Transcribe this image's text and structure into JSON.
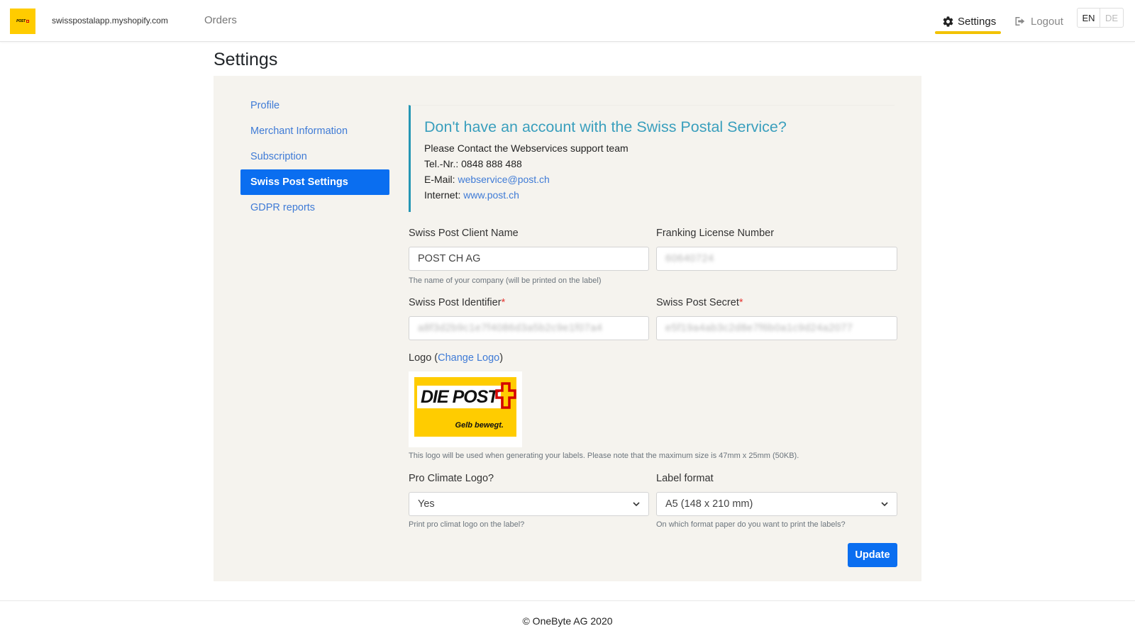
{
  "navbar": {
    "shop_name": "swisspostalapp.myshopify.com",
    "orders_label": "Orders",
    "settings_label": "Settings",
    "logout_label": "Logout",
    "languages": [
      "EN",
      "DE"
    ],
    "active_language": "EN",
    "accent_color": "#f2c200"
  },
  "page": {
    "title": "Settings"
  },
  "sidebar": {
    "items": [
      {
        "label": "Profile"
      },
      {
        "label": "Merchant Information"
      },
      {
        "label": "Subscription"
      },
      {
        "label": "Swiss Post Settings"
      },
      {
        "label": "GDPR reports"
      }
    ],
    "active_index": 3
  },
  "info": {
    "title": "Don't have an account with the Swiss Postal Service?",
    "line1": "Please Contact the Webservices support team",
    "tel_prefix": "Tel.-Nr.: ",
    "tel": "0848 888 488",
    "email_prefix": "E-Mail: ",
    "email": "webservice@post.ch",
    "internet_prefix": "Internet: ",
    "internet": "www.post.ch"
  },
  "form": {
    "client_name_label": "Swiss Post Client Name",
    "client_name_value": "POST CH AG",
    "client_name_help": "The name of your company (will be printed on the label)",
    "franking_label": "Franking License Number",
    "franking_value": "60640724",
    "identifier_label": "Swiss Post Identifier",
    "identifier_value": "a8f3d2b9c1e7f4086d3a5b2c9e1f07a4",
    "secret_label": "Swiss Post Secret",
    "secret_value": "e5f19a4ab3c2d8e7f6b0a1c9d24a2077",
    "required_mark": "*",
    "logo_label_prefix": "Logo (",
    "logo_change_link": "Change Logo",
    "logo_label_suffix": ")",
    "logo_image": {
      "main_text": "DIE POST",
      "tagline": "Gelb bewegt."
    },
    "logo_help": "This logo will be used when generating your labels. Please note that the maximum size is 47mm x 25mm (50KB).",
    "pro_climate_label": "Pro Climate Logo?",
    "pro_climate_value": "Yes",
    "pro_climate_help": "Print pro climat logo on the label?",
    "label_format_label": "Label format",
    "label_format_value": "A5 (148 x 210 mm)",
    "label_format_help": "On which format paper do you want to print the labels?",
    "update_button": "Update"
  },
  "footer": {
    "text": "© OneByte AG 2020"
  },
  "colors": {
    "primary": "#0a6ef0",
    "link": "#3f7bd6",
    "info_accent": "#2596b4",
    "panel_bg": "#f5f3ee",
    "swiss_post_yellow": "#ffcc00",
    "swiss_post_red": "#d40000"
  },
  "icons": [
    "gear-icon",
    "logout-icon",
    "chevron-down-icon",
    "swiss-cross-icon"
  ]
}
